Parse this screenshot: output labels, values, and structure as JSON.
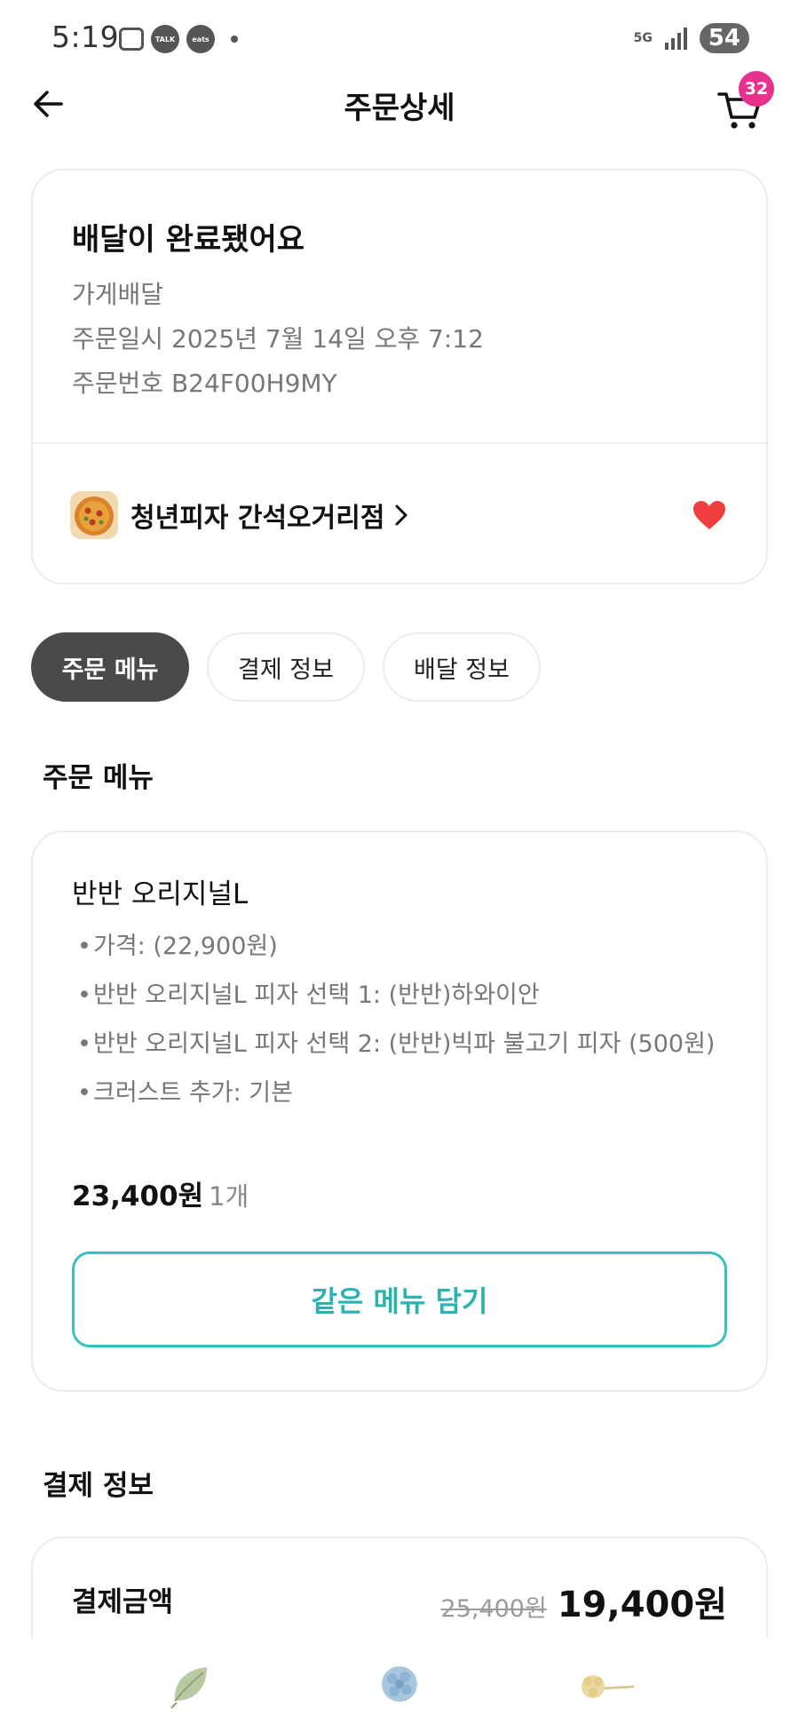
{
  "status_bar": {
    "time": "5:19",
    "icons_left": [
      "screenshot-icon",
      "kakaotalk-icon",
      "coupang-eats-icon",
      "dot-icon"
    ],
    "network": "5G",
    "battery": "54"
  },
  "header": {
    "title": "주문상세",
    "cart_count": "32"
  },
  "order_status": {
    "title": "배달이 완료됐어요",
    "delivery_type": "가게배달",
    "order_datetime": "주문일시 2025년 7월 14일 오후 7:12",
    "order_number": "주문번호 B24F00H9MY",
    "store_name": "청년피자 간석오거리점",
    "favorited": true
  },
  "tabs": [
    {
      "label": "주문 메뉴",
      "active": true
    },
    {
      "label": "결제 정보",
      "active": false
    },
    {
      "label": "배달 정보",
      "active": false
    }
  ],
  "order_menu": {
    "section_title": "주문 메뉴",
    "item_name": "반반 오리지널L",
    "options": [
      "가격: (22,900원)",
      "반반 오리지널L 피자 선택 1: (반반)하와이안",
      "반반 오리지널L 피자 선택 2: (반반)빅파 불고기 피자 (500원)",
      "크러스트 추가: 기본"
    ],
    "price": "23,400원",
    "quantity": "1개",
    "add_same_label": "같은 메뉴 담기"
  },
  "payment": {
    "section_title": "결제 정보",
    "label": "결제금액",
    "original_price": "25,400원",
    "final_price": "19,400원"
  },
  "bottom_nav": [
    "leaf-icon",
    "flower-blue-icon",
    "flower-yellow-icon"
  ],
  "colors": {
    "accent_teal": "#2cb3b0",
    "badge_pink": "#e8318c",
    "heart_red": "#f03e3e",
    "active_tab": "#4a4a4a"
  }
}
